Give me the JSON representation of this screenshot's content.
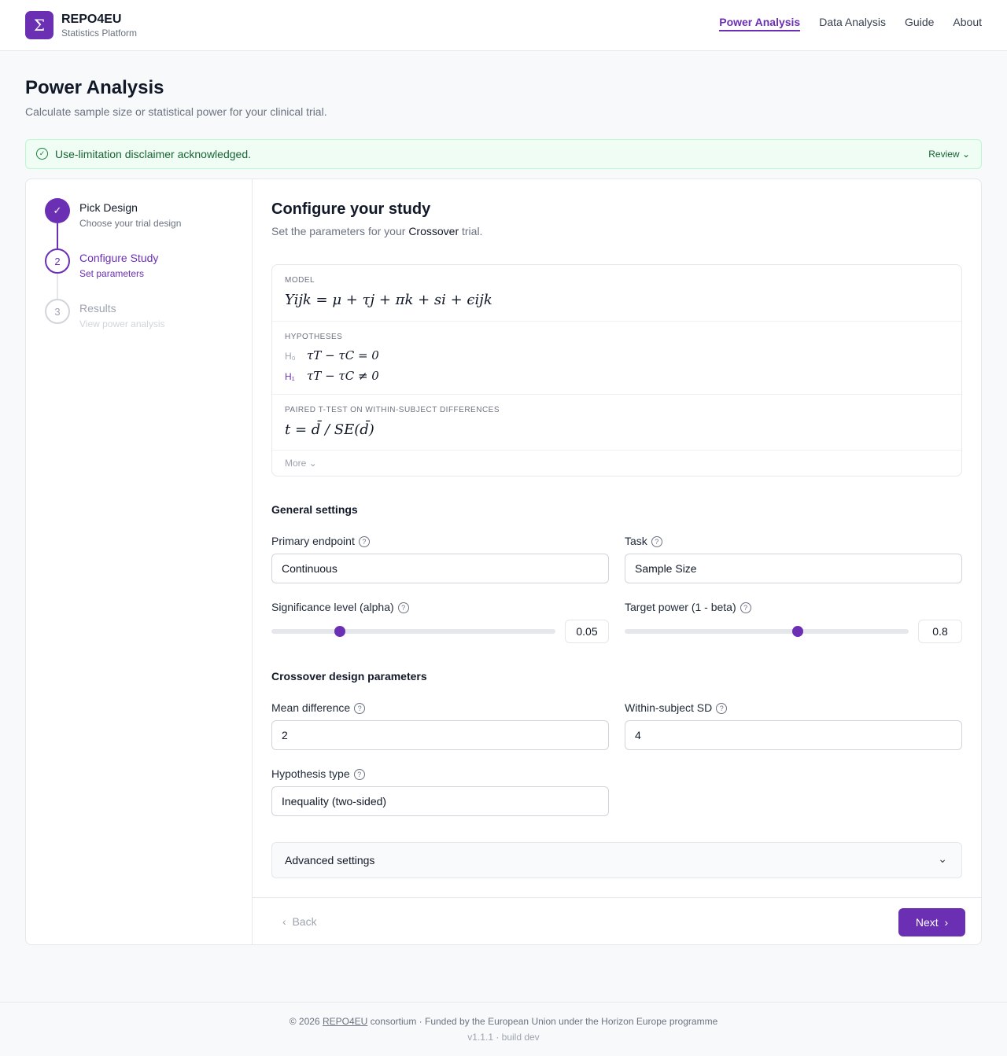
{
  "header": {
    "logo_glyph": "Σ",
    "brand_name": "REPO4EU",
    "brand_sub": "Statistics Platform",
    "nav": [
      "Power Analysis",
      "Data Analysis",
      "Guide",
      "About"
    ]
  },
  "page": {
    "title": "Power Analysis",
    "subtitle": "Calculate sample size or statistical power for your clinical trial."
  },
  "notice": {
    "text": "Use-limitation disclaimer acknowledged.",
    "action": "Review"
  },
  "steps": [
    {
      "title": "Pick Design",
      "desc": "Choose your trial design",
      "state": "done"
    },
    {
      "title": "Configure Study",
      "desc": "Set parameters",
      "state": "active",
      "num": "2"
    },
    {
      "title": "Results",
      "desc": "View power analysis",
      "state": "todo",
      "num": "3"
    }
  ],
  "config": {
    "title": "Configure your study",
    "sub_prefix": "Set the parameters for your",
    "design": "Crossover",
    "sub_suffix": "trial."
  },
  "model": {
    "model_label": "MODEL",
    "model_eq": "Yijk = μ + τj + πk + si + ϵijk",
    "hyp_label": "HYPOTHESES",
    "h0_label": "H₀",
    "h0_eq": "τT − τC = 0",
    "h1_label": "H₁",
    "h1_eq": "τT − τC ≠ 0",
    "test_label": "PAIRED T-TEST ON WITHIN-SUBJECT DIFFERENCES",
    "test_eq": "t = d̄ / SE(d̄)",
    "more": "More"
  },
  "general": {
    "heading": "General settings",
    "endpoint_label": "Primary endpoint",
    "endpoint_value": "Continuous",
    "task_label": "Task",
    "task_value": "Sample Size",
    "alpha_label": "Significance level (alpha)",
    "alpha_value": "0.05",
    "alpha_fraction": 0.24,
    "power_label": "Target power (1 - beta)",
    "power_value": "0.8",
    "power_fraction": 0.61
  },
  "crossover": {
    "heading": "Crossover design parameters",
    "mean_label": "Mean difference",
    "mean_value": "2",
    "sd_label": "Within-subject SD",
    "sd_value": "4",
    "hyp_label": "Hypothesis type",
    "hyp_value": "Inequality (two-sided)"
  },
  "advanced": {
    "label": "Advanced settings"
  },
  "actions": {
    "back": "Back",
    "next": "Next"
  },
  "footer": {
    "line1_prefix": "© 2026",
    "line1_link": "REPO4EU",
    "line1_suffix": "consortium · Funded by the European Union under the Horizon Europe programme",
    "line2": "v1.1.1 · build dev"
  }
}
